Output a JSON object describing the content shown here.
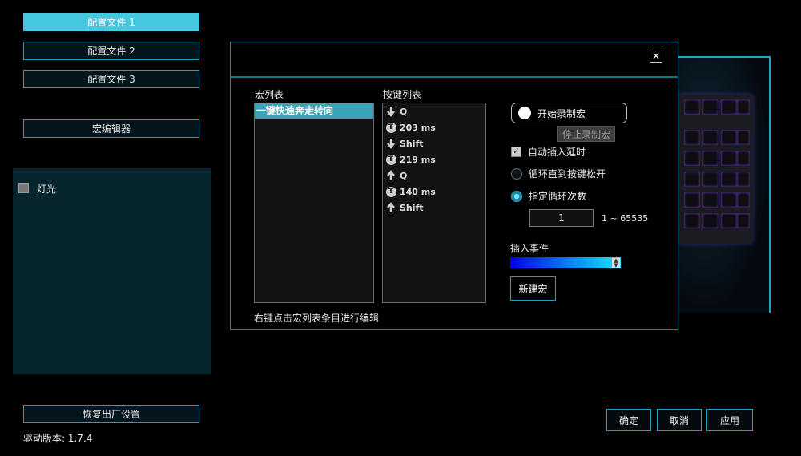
{
  "sidebar": {
    "profiles": [
      "配置文件 1",
      "配置文件 2",
      "配置文件 3"
    ],
    "macro_editor": "宏编辑器",
    "lighting_label": "灯光",
    "factory_reset": "恢复出厂设置",
    "driver_version": "驱动版本:  1.7.4"
  },
  "footer": {
    "ok": "确定",
    "cancel": "取消",
    "apply": "应用"
  },
  "dialog": {
    "close_glyph": "✕",
    "macro_list_title": "宏列表",
    "macro_items": [
      "一键快速奔走转向"
    ],
    "key_list_title": "按键列表",
    "key_events": [
      {
        "icon": "arrow-down-icon",
        "text": "Q"
      },
      {
        "icon": "timer-icon",
        "text": "203 ms"
      },
      {
        "icon": "arrow-down-icon",
        "text": "Shift"
      },
      {
        "icon": "timer-icon",
        "text": "219 ms"
      },
      {
        "icon": "arrow-up-icon",
        "text": "Q"
      },
      {
        "icon": "timer-icon",
        "text": "140 ms"
      },
      {
        "icon": "arrow-up-icon",
        "text": "Shift"
      }
    ],
    "timer_glyph": "T",
    "start_record": "开始录制宏",
    "stop_record": "停止录制宏",
    "auto_insert_delay": "自动插入延时",
    "loop_until_release": "循环直到按键松开",
    "specify_loop_count": "指定循环次数",
    "loop_count_value": "1",
    "loop_count_range": "1 ~ 65535",
    "insert_event": "插入事件",
    "new_macro": "新建宏",
    "hint": "右键点击宏列表条目进行编辑"
  },
  "colors": {
    "accent": "#19a6bd",
    "active": "#45c9e0"
  }
}
